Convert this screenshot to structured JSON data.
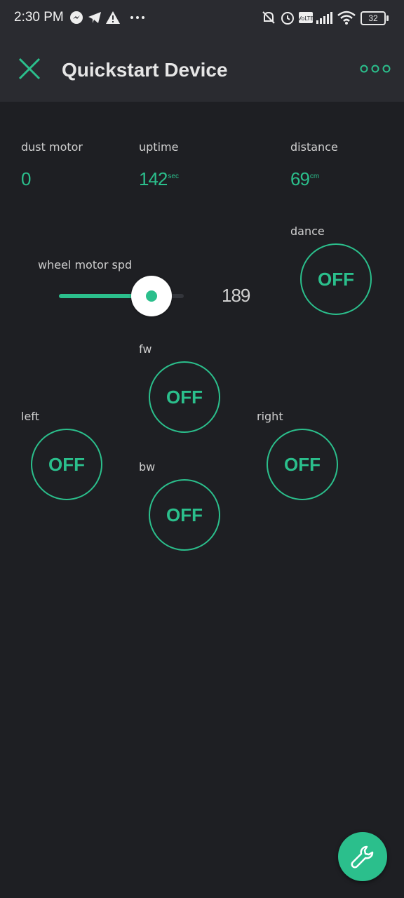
{
  "status_bar": {
    "time": "2:30 PM",
    "battery": "32",
    "icons": [
      "messenger-icon",
      "telegram-icon",
      "warning-icon",
      "more-dots-icon",
      "mute-bell-icon",
      "alarm-icon",
      "volte-icon",
      "signal-icon",
      "wifi-icon",
      "battery-icon"
    ]
  },
  "app_bar": {
    "title": "Quickstart Device",
    "close_icon": "close-icon",
    "more_icon": "more-options-icon"
  },
  "widgets": {
    "dust_motor": {
      "label": "dust motor",
      "value": "0"
    },
    "uptime": {
      "label": "uptime",
      "value": "142",
      "unit": "sec"
    },
    "distance": {
      "label": "distance",
      "value": "69",
      "unit": "cm"
    },
    "wheel_motor": {
      "label": "wheel motor spd",
      "value": "189",
      "min": 0,
      "max": 255,
      "fraction": 0.74
    },
    "dance": {
      "label": "dance",
      "state": "OFF"
    },
    "fw": {
      "label": "fw",
      "state": "OFF"
    },
    "left": {
      "label": "left",
      "state": "OFF"
    },
    "right": {
      "label": "right",
      "state": "OFF"
    },
    "bw": {
      "label": "bw",
      "state": "OFF"
    }
  },
  "fab": {
    "icon": "wrench-icon"
  },
  "colors": {
    "accent": "#2bbf8c",
    "background": "#1e1f23",
    "bar": "#2a2b30"
  }
}
